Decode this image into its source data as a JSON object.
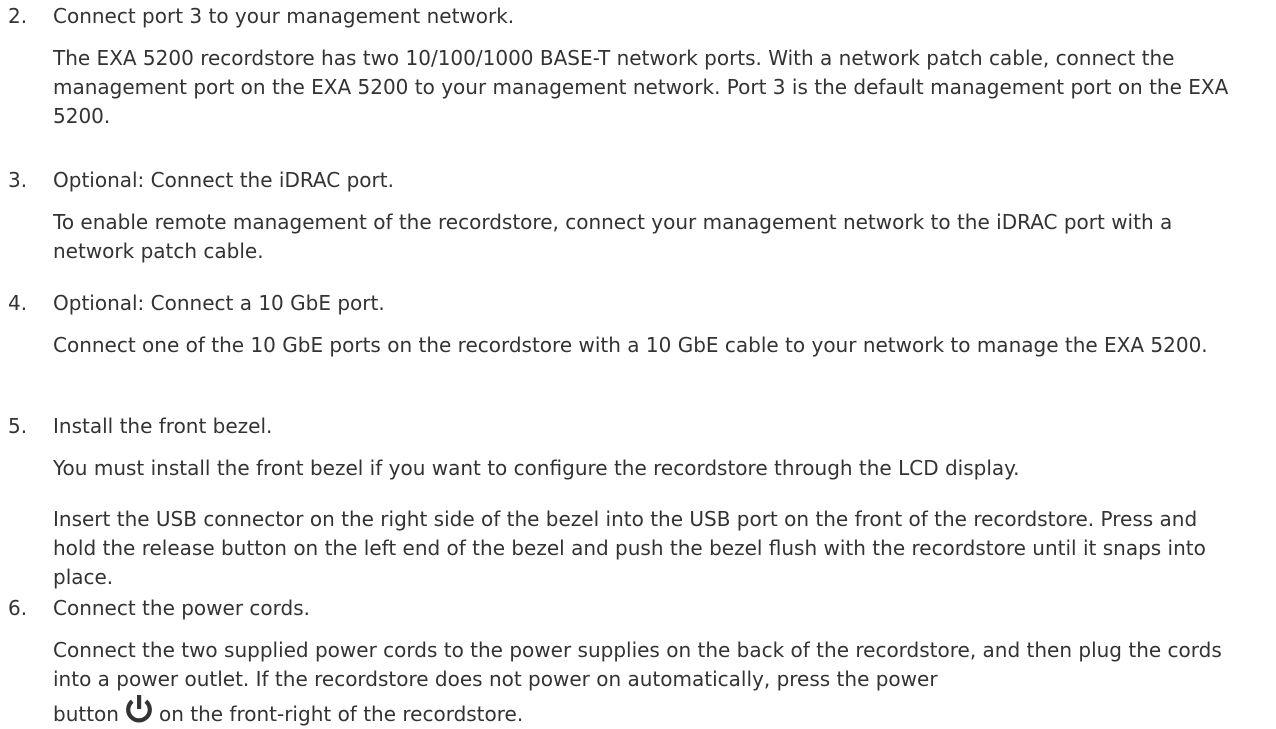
{
  "steps": [
    {
      "number": "2.",
      "title": "Connect port 3 to your management network.",
      "paragraphs": [
        "The EXA 5200 recordstore has two 10/100/1000 BASE-T network ports. With a network patch cable, connect the management port on the EXA 5200 to your management network. Port 3 is the default management port on the EXA 5200."
      ]
    },
    {
      "number": "3.",
      "title": "Optional: Connect the iDRAC port.",
      "paragraphs": [
        "To enable remote management of the recordstore, connect your management network to the iDRAC port with a network patch cable."
      ]
    },
    {
      "number": "4.",
      "title": "Optional: Connect a 10 GbE port.",
      "paragraphs": [
        "Connect one of the 10 GbE ports on the recordstore with a 10 GbE cable to your network to manage the EXA 5200."
      ]
    },
    {
      "number": "5.",
      "title": "Install the front bezel.",
      "paragraphs": [
        "You must install the front bezel if you want to configure the recordstore through the LCD display.",
        "Insert the USB connector on the right side of the bezel into the USB port on the front of the recordstore. Press and hold the release button on the left end of the bezel and push the bezel flush with the recordstore until it snaps into place."
      ]
    },
    {
      "number": "6.",
      "title": "Connect the power cords.",
      "paragraphs": [
        "Connect the two supplied power cords to the power supplies on the back of the recordstore, and then plug the cords into a power outlet. If the recordstore does not power on automatically, press the power"
      ],
      "final_line_before_icon": "button",
      "final_line_icon": "power-icon",
      "final_line_after_icon": "on the front-right of the recordstore."
    }
  ]
}
